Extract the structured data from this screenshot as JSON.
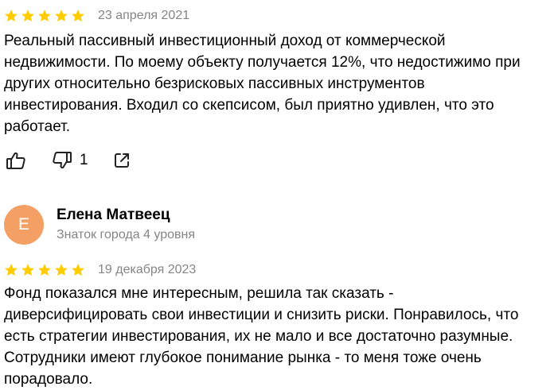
{
  "colors": {
    "star": "#fc0",
    "avatar_bg": "#f4a064",
    "muted_text": "#858585"
  },
  "reviews": [
    {
      "rating": 5,
      "date": "23 апреля 2021",
      "text": "Реальный пассивный инвестиционный доход от коммерческой\nнедвижимости. По моему объекту получается 12%, что недостижимо при\nдругих относительно безрисковых пассивных инструментов\nинвестирования. Входил со скепсисом, был приятно удивлен, что это\nработает.",
      "actions": {
        "like_icon": "thumbs-up-icon",
        "dislike_icon": "thumbs-down-icon",
        "dislike_count": "1",
        "share_icon": "share-icon"
      }
    },
    {
      "author": {
        "initial": "Е",
        "name": "Елена Матвеец",
        "level": "Знаток города 4 уровня"
      },
      "rating": 5,
      "date": "19 декабря 2023",
      "text": "Фонд показался мне интересным, решила так сказать -\nдиверсифицировать свои инвестиции и снизить риски. Понравилось, что\nесть стратегии инвестирования, их не мало и все достаточно разумные.\nСотрудники имеют глубокое понимание рынка - то меня тоже очень\nпорадовало."
    }
  ]
}
